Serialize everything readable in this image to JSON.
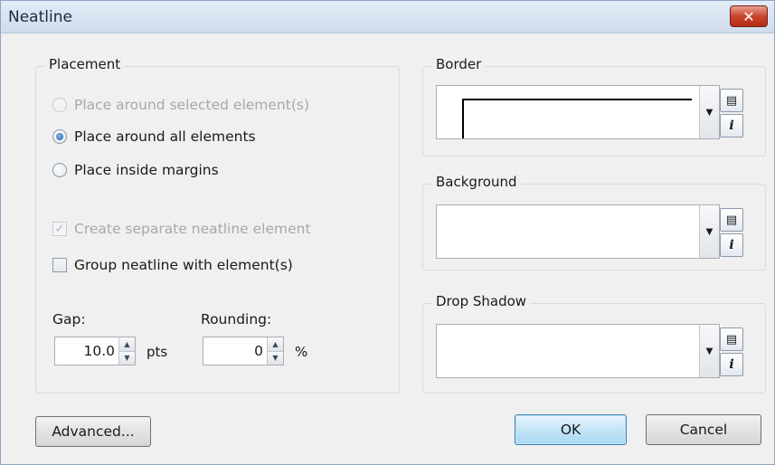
{
  "window": {
    "title": "Neatline",
    "close_label": "✕"
  },
  "placement": {
    "title": "Placement",
    "radios": [
      {
        "label": "Place around selected element(s)",
        "checked": false,
        "enabled": false
      },
      {
        "label": "Place around all elements",
        "checked": true,
        "enabled": true
      },
      {
        "label": "Place inside margins",
        "checked": false,
        "enabled": true
      }
    ],
    "create_separate": {
      "label": "Create separate neatline element",
      "checked": true,
      "enabled": false
    },
    "group_neatline": {
      "label": "Group neatline with element(s)",
      "checked": false,
      "enabled": true
    },
    "gap": {
      "label": "Gap:",
      "value": "10.0",
      "unit": "pts"
    },
    "rounding": {
      "label": "Rounding:",
      "value": "0",
      "unit": "%"
    }
  },
  "border": {
    "title": "Border"
  },
  "background": {
    "title": "Background"
  },
  "drop_shadow": {
    "title": "Drop Shadow"
  },
  "buttons": {
    "advanced": "Advanced...",
    "ok": "OK",
    "cancel": "Cancel"
  },
  "icons": {
    "properties": "properties-icon",
    "info": "info-icon",
    "dropdown": "chevron-down-icon"
  },
  "glyphs": {
    "check": "✓",
    "spin_up": "▲",
    "spin_down": "▼",
    "drop": "▼",
    "list": "▤",
    "info": "i"
  },
  "colors": {
    "close_button": "#c8452d",
    "default_button": "#a7d8f2"
  }
}
